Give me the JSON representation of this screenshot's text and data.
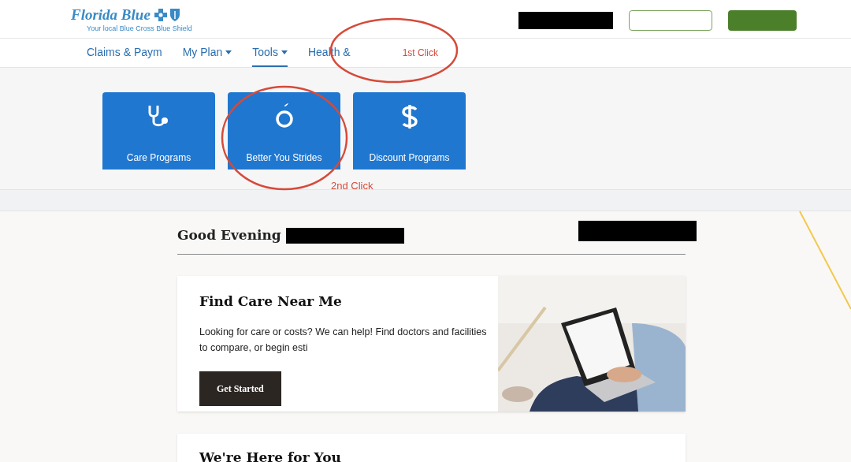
{
  "header": {
    "logo": {
      "name": "Florida Blue",
      "tagline": "Your local Blue Cross Blue Shield"
    }
  },
  "nav": [
    {
      "label": "Claims & Paym",
      "dropdown": false,
      "selected": false
    },
    {
      "label": "My Plan",
      "dropdown": true,
      "selected": false
    },
    {
      "label": "Tools",
      "dropdown": true,
      "selected": true
    },
    {
      "label": "Health &",
      "dropdown": false,
      "selected": false
    }
  ],
  "annotations": [
    {
      "label": "1st Click"
    },
    {
      "label": "2nd Click"
    }
  ],
  "tiles": [
    {
      "label": "Care Programs",
      "kind": "stethoscope"
    },
    {
      "label": "Better You Strides",
      "kind": "apple"
    },
    {
      "label": "Discount Programs",
      "kind": "dollar"
    }
  ],
  "greeting": "Good Evening",
  "cards": [
    {
      "title": "Find Care Near Me",
      "body": [
        "Looking for care or costs? We can help! Find doctors and facilities",
        "to compare, or begin esti"
      ],
      "button": "Get Started",
      "image": {
        "kind": "picture"
      }
    },
    {
      "title": "We're Here for You"
    }
  ]
}
